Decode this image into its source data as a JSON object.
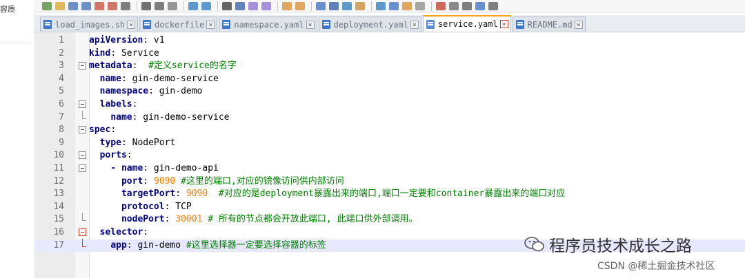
{
  "left_panel": {
    "label": "容质"
  },
  "toolbar": {
    "icons": [
      "new-file-icon",
      "open-icon",
      "save-icon",
      "save-all-icon",
      "close-icon",
      "close-all-icon",
      "print-icon",
      "cut-icon",
      "copy-icon",
      "paste-icon",
      "undo-icon",
      "redo-icon",
      "find-icon",
      "replace-icon",
      "zoom-in-icon",
      "zoom-out-icon",
      "sync-v-icon",
      "sync-h-icon",
      "word-wrap-icon",
      "show-all-icon",
      "indent-guide-icon",
      "udl-icon",
      "doc-map-icon",
      "function-list-icon",
      "folder-workspace-icon",
      "monitor-icon",
      "record-macro-icon",
      "stop-record-icon",
      "playback-icon",
      "run-macro-icon",
      "save-macro-icon"
    ]
  },
  "tabs": [
    {
      "label": "load_images.sh",
      "active": false
    },
    {
      "label": "dockerfile",
      "active": false
    },
    {
      "label": "namespace.yaml",
      "active": false
    },
    {
      "label": "deployment.yaml",
      "active": false
    },
    {
      "label": "service.yaml",
      "active": true
    },
    {
      "label": "README.md",
      "active": false
    }
  ],
  "editor": {
    "current_line": 17,
    "lines": [
      {
        "num": "1",
        "parts": [
          [
            "k",
            "apiVersion"
          ],
          [
            "v",
            ": v1"
          ]
        ]
      },
      {
        "num": "2",
        "parts": [
          [
            "k",
            "kind"
          ],
          [
            "v",
            ": Service"
          ]
        ]
      },
      {
        "num": "3",
        "parts": [
          [
            "k",
            "metadata"
          ],
          [
            "v",
            ":  "
          ],
          [
            "c",
            "#定义service的名字"
          ]
        ]
      },
      {
        "num": "4",
        "parts": [
          [
            "v",
            "  "
          ],
          [
            "k",
            "name"
          ],
          [
            "v",
            ": gin-demo-service"
          ]
        ]
      },
      {
        "num": "5",
        "parts": [
          [
            "v",
            "  "
          ],
          [
            "k",
            "namespace"
          ],
          [
            "v",
            ": gin-demo"
          ]
        ]
      },
      {
        "num": "6",
        "parts": [
          [
            "v",
            "  "
          ],
          [
            "k",
            "labels"
          ],
          [
            "v",
            ":"
          ]
        ]
      },
      {
        "num": "7",
        "parts": [
          [
            "v",
            "    "
          ],
          [
            "k",
            "name"
          ],
          [
            "v",
            ": gin-demo-service"
          ]
        ]
      },
      {
        "num": "8",
        "parts": [
          [
            "k",
            "spec"
          ],
          [
            "v",
            ":"
          ]
        ]
      },
      {
        "num": "9",
        "parts": [
          [
            "v",
            "  "
          ],
          [
            "k",
            "type"
          ],
          [
            "v",
            ": NodePort"
          ]
        ]
      },
      {
        "num": "10",
        "parts": [
          [
            "v",
            "  "
          ],
          [
            "k",
            "ports"
          ],
          [
            "v",
            ":"
          ]
        ]
      },
      {
        "num": "11",
        "parts": [
          [
            "v",
            "    "
          ],
          [
            "k",
            "- name"
          ],
          [
            "v",
            ": gin-demo-api"
          ]
        ]
      },
      {
        "num": "12",
        "parts": [
          [
            "v",
            "      "
          ],
          [
            "k",
            "port"
          ],
          [
            "v",
            ": "
          ],
          [
            "n",
            "9090"
          ],
          [
            "v",
            " "
          ],
          [
            "c",
            "#这里的端口,对应的镜像访问供内部访问"
          ]
        ]
      },
      {
        "num": "13",
        "parts": [
          [
            "v",
            "      "
          ],
          [
            "k",
            "targetPort"
          ],
          [
            "v",
            ": "
          ],
          [
            "n",
            "9090"
          ],
          [
            "v",
            "  "
          ],
          [
            "c",
            "#对应的是deployment暴露出来的端口,端口一定要和container暴露出来的端口对应"
          ]
        ]
      },
      {
        "num": "14",
        "parts": [
          [
            "v",
            "      "
          ],
          [
            "k",
            "protocol"
          ],
          [
            "v",
            ": TCP"
          ]
        ]
      },
      {
        "num": "15",
        "parts": [
          [
            "v",
            "      "
          ],
          [
            "k",
            "nodePort"
          ],
          [
            "v",
            ": "
          ],
          [
            "n",
            "30001"
          ],
          [
            "v",
            " "
          ],
          [
            "c",
            "# 所有的节点都会开放此端口, 此端口供外部调用。"
          ]
        ]
      },
      {
        "num": "16",
        "parts": [
          [
            "v",
            "  "
          ],
          [
            "k",
            "selector"
          ],
          [
            "v",
            ":"
          ]
        ]
      },
      {
        "num": "17",
        "parts": [
          [
            "v",
            "    "
          ],
          [
            "k",
            "app"
          ],
          [
            "v",
            ": gin-demo "
          ],
          [
            "c",
            "#这里选择器一定要选择容器的标签"
          ]
        ]
      }
    ],
    "folds": [
      "",
      "",
      "box",
      "",
      "",
      "box",
      "end",
      "box",
      "",
      "box",
      "box",
      "",
      "",
      "",
      "end",
      "boxred",
      "endred"
    ]
  },
  "watermark": {
    "title": "程序员技术成长之路",
    "subtitle": "CSDN @稀土掘金技术社区"
  },
  "colors": {
    "keyword": "#000080",
    "number": "#ff8000",
    "comment": "#008000",
    "current_line": "#e8e8ff",
    "active_tab_accent": "#f7a21b"
  }
}
